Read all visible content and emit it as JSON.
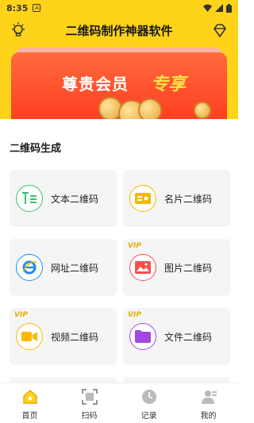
{
  "status": {
    "time": "8:35",
    "notif": "A"
  },
  "header": {
    "title": "二维码制作神器软件"
  },
  "banner": {
    "title": "尊贵会员",
    "accent": "专享"
  },
  "section": {
    "title": "二维码生成"
  },
  "vip_tag": "VIP",
  "cards": [
    {
      "label": "文本二维码",
      "icon": "text-icon",
      "color": "#36c36b",
      "vip": false
    },
    {
      "label": "名片二维码",
      "icon": "card-icon",
      "color": "#f5b800",
      "vip": false
    },
    {
      "label": "网址二维码",
      "icon": "ie-icon",
      "color": "#1e8cf0",
      "vip": false
    },
    {
      "label": "图片二维码",
      "icon": "image-icon",
      "color": "#ff4d4f",
      "vip": true
    },
    {
      "label": "视频二维码",
      "icon": "video-icon",
      "color": "#ffb800",
      "vip": true
    },
    {
      "label": "文件二维码",
      "icon": "folder-icon",
      "color": "#a248e0",
      "vip": true
    }
  ],
  "tabs": [
    {
      "label": "首页",
      "icon": "home-icon",
      "active": true
    },
    {
      "label": "扫码",
      "icon": "scan-icon",
      "active": false
    },
    {
      "label": "记录",
      "icon": "record-icon",
      "active": false
    },
    {
      "label": "我的",
      "icon": "profile-icon",
      "active": false
    }
  ],
  "colors": {
    "brand": "#ffd31a",
    "banner": "#ff3b1f",
    "accent": "#ffe14a"
  }
}
